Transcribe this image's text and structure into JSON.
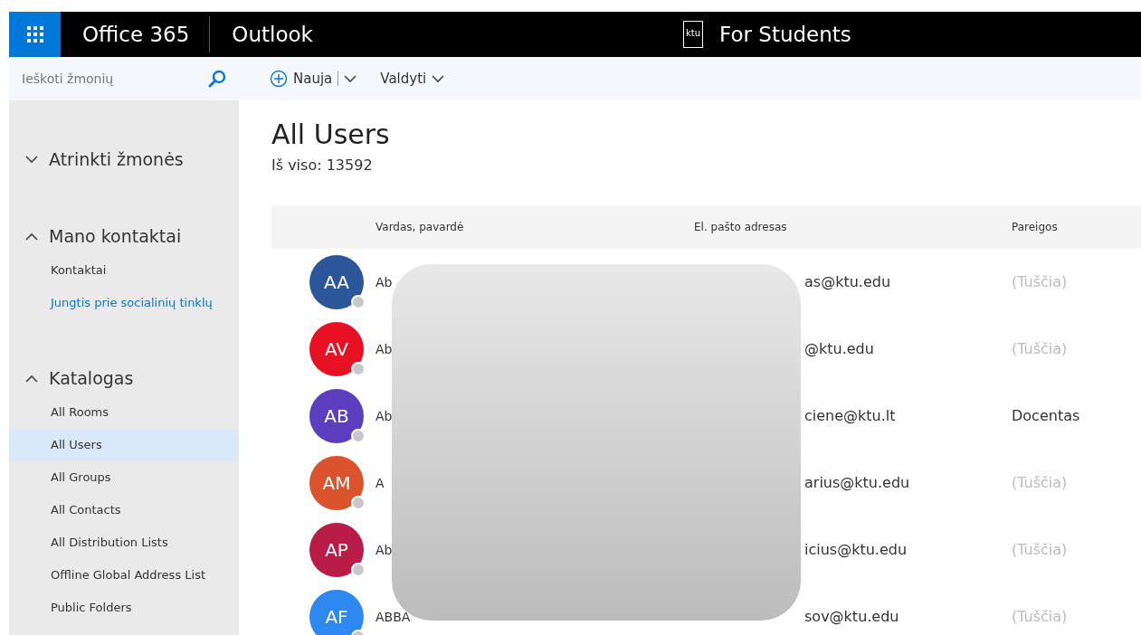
{
  "top_bar": {
    "suite_title": "Office 365",
    "app_title": "Outlook",
    "logo_text": "ktu",
    "org_title": "For Students"
  },
  "search": {
    "placeholder": "Ieškoti žmonių"
  },
  "toolbar": [
    {
      "label": "Nauja",
      "kind": "split"
    },
    {
      "label": "Valdyti",
      "kind": "menu"
    }
  ],
  "sidebar": {
    "sections": [
      {
        "title": "Atrinkti žmonės",
        "expanded": false
      },
      {
        "title": "Mano kontaktai",
        "expanded": true,
        "items": [
          {
            "label": "Kontaktai",
            "kind": "item",
            "selected": false
          },
          {
            "label": "Jungtis prie socialinių tinklų",
            "kind": "link",
            "selected": false
          }
        ]
      },
      {
        "title": "Katalogas",
        "expanded": true,
        "items": [
          {
            "label": "All Rooms",
            "kind": "item",
            "selected": false
          },
          {
            "label": "All Users",
            "kind": "item",
            "selected": true
          },
          {
            "label": "All Groups",
            "kind": "item",
            "selected": false
          },
          {
            "label": "All Contacts",
            "kind": "item",
            "selected": false
          },
          {
            "label": "All Distribution Lists",
            "kind": "item",
            "selected": false
          },
          {
            "label": "Offline Global Address List",
            "kind": "item",
            "selected": false
          },
          {
            "label": "Public Folders",
            "kind": "item",
            "selected": false
          }
        ]
      }
    ]
  },
  "list": {
    "title": "All Users",
    "count": "Iš viso: 13592",
    "columns": [
      "Vardas, pavardė",
      "El. pašto adresas",
      "Pareigos"
    ],
    "rows": [
      {
        "initials": "AA",
        "color": "#2b579a",
        "name": "Ab",
        "email": "as@ktu.edu",
        "role": "(Tuščia)",
        "role_empty": true
      },
      {
        "initials": "AV",
        "color": "#e81123",
        "name": "Ab",
        "email": "@ktu.edu",
        "role": "(Tuščia)",
        "role_empty": true
      },
      {
        "initials": "AB",
        "color": "#5c3fbf",
        "name": "Ab",
        "email": "ciene@ktu.lt",
        "role": "Docentas",
        "role_empty": false
      },
      {
        "initials": "AM",
        "color": "#da532c",
        "name": "A",
        "email": "arius@ktu.edu",
        "role": "(Tuščia)",
        "role_empty": true
      },
      {
        "initials": "AP",
        "color": "#b91d47",
        "name": "Ab",
        "email": "icius@ktu.edu",
        "role": "(Tuščia)",
        "role_empty": true
      },
      {
        "initials": "AF",
        "color": "#2d89ef",
        "name": "ABBA",
        "email": "sov@ktu.edu",
        "role": "(Tuščia)",
        "role_empty": true
      }
    ]
  }
}
